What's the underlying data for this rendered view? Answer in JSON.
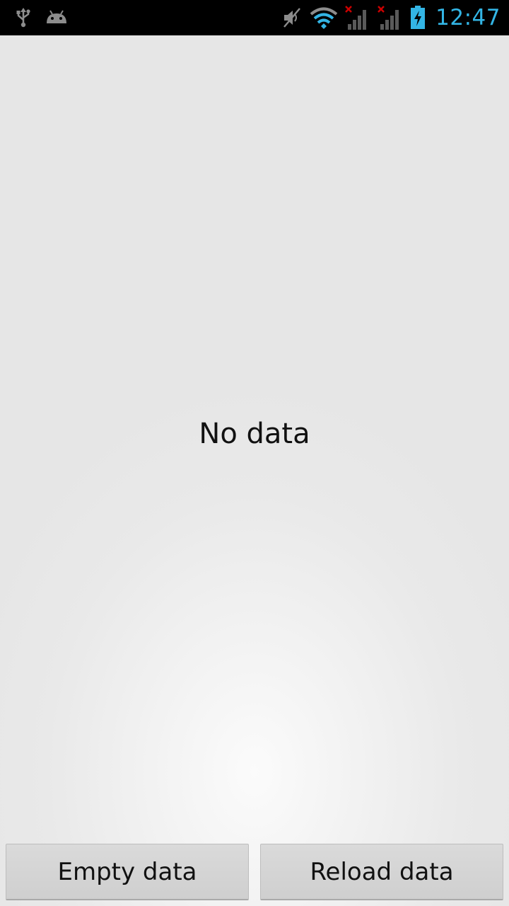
{
  "status_bar": {
    "left_icons": [
      "usb-icon",
      "android-debug-icon"
    ],
    "right_icons": [
      "mute-icon",
      "wifi-icon",
      "signal-no-service-icon",
      "signal-no-service-icon",
      "battery-charging-icon"
    ],
    "time": "12:47",
    "colors": {
      "background": "#000000",
      "clock": "#33b5e5",
      "icon": "#8c8c8c",
      "no_service_x": "#cc0000"
    }
  },
  "main": {
    "empty_message": "No data"
  },
  "buttons": {
    "empty_label": "Empty data",
    "reload_label": "Reload data"
  }
}
